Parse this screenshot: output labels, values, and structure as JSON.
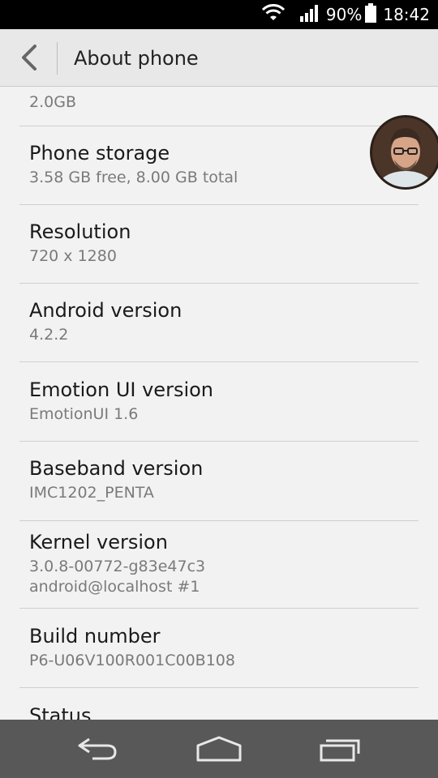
{
  "status_bar": {
    "battery_percent": "90%",
    "time": "18:42",
    "icons": [
      "wifi-icon",
      "signal-icon",
      "battery-icon"
    ]
  },
  "header": {
    "title": "About phone",
    "back_icon": "chevron-left-icon"
  },
  "items": [
    {
      "title": "",
      "values": [
        "2.0GB"
      ]
    },
    {
      "title": "Phone storage",
      "values": [
        "3.58 GB free, 8.00 GB total"
      ]
    },
    {
      "title": "Resolution",
      "values": [
        "720 x 1280"
      ]
    },
    {
      "title": "Android version",
      "values": [
        "4.2.2"
      ]
    },
    {
      "title": "Emotion UI version",
      "values": [
        "EmotionUI 1.6"
      ]
    },
    {
      "title": "Baseband version",
      "values": [
        "IMC1202_PENTA"
      ]
    },
    {
      "title": "Kernel version",
      "values": [
        "3.0.8-00772-g83e47c3",
        "android@localhost #1"
      ]
    },
    {
      "title": "Build number",
      "values": [
        "P6-U06V100R001C00B108"
      ]
    },
    {
      "title": "Status",
      "values": []
    }
  ],
  "navigation": {
    "icons": [
      "back-icon",
      "home-icon",
      "recent-apps-icon"
    ]
  },
  "colors": {
    "status_bar_bg": "#000000",
    "title_bar_bg": "#e8e8e8",
    "content_bg": "#f2f2f2",
    "nav_bar_bg": "#585858",
    "secondary_text": "#7a7a7a"
  }
}
